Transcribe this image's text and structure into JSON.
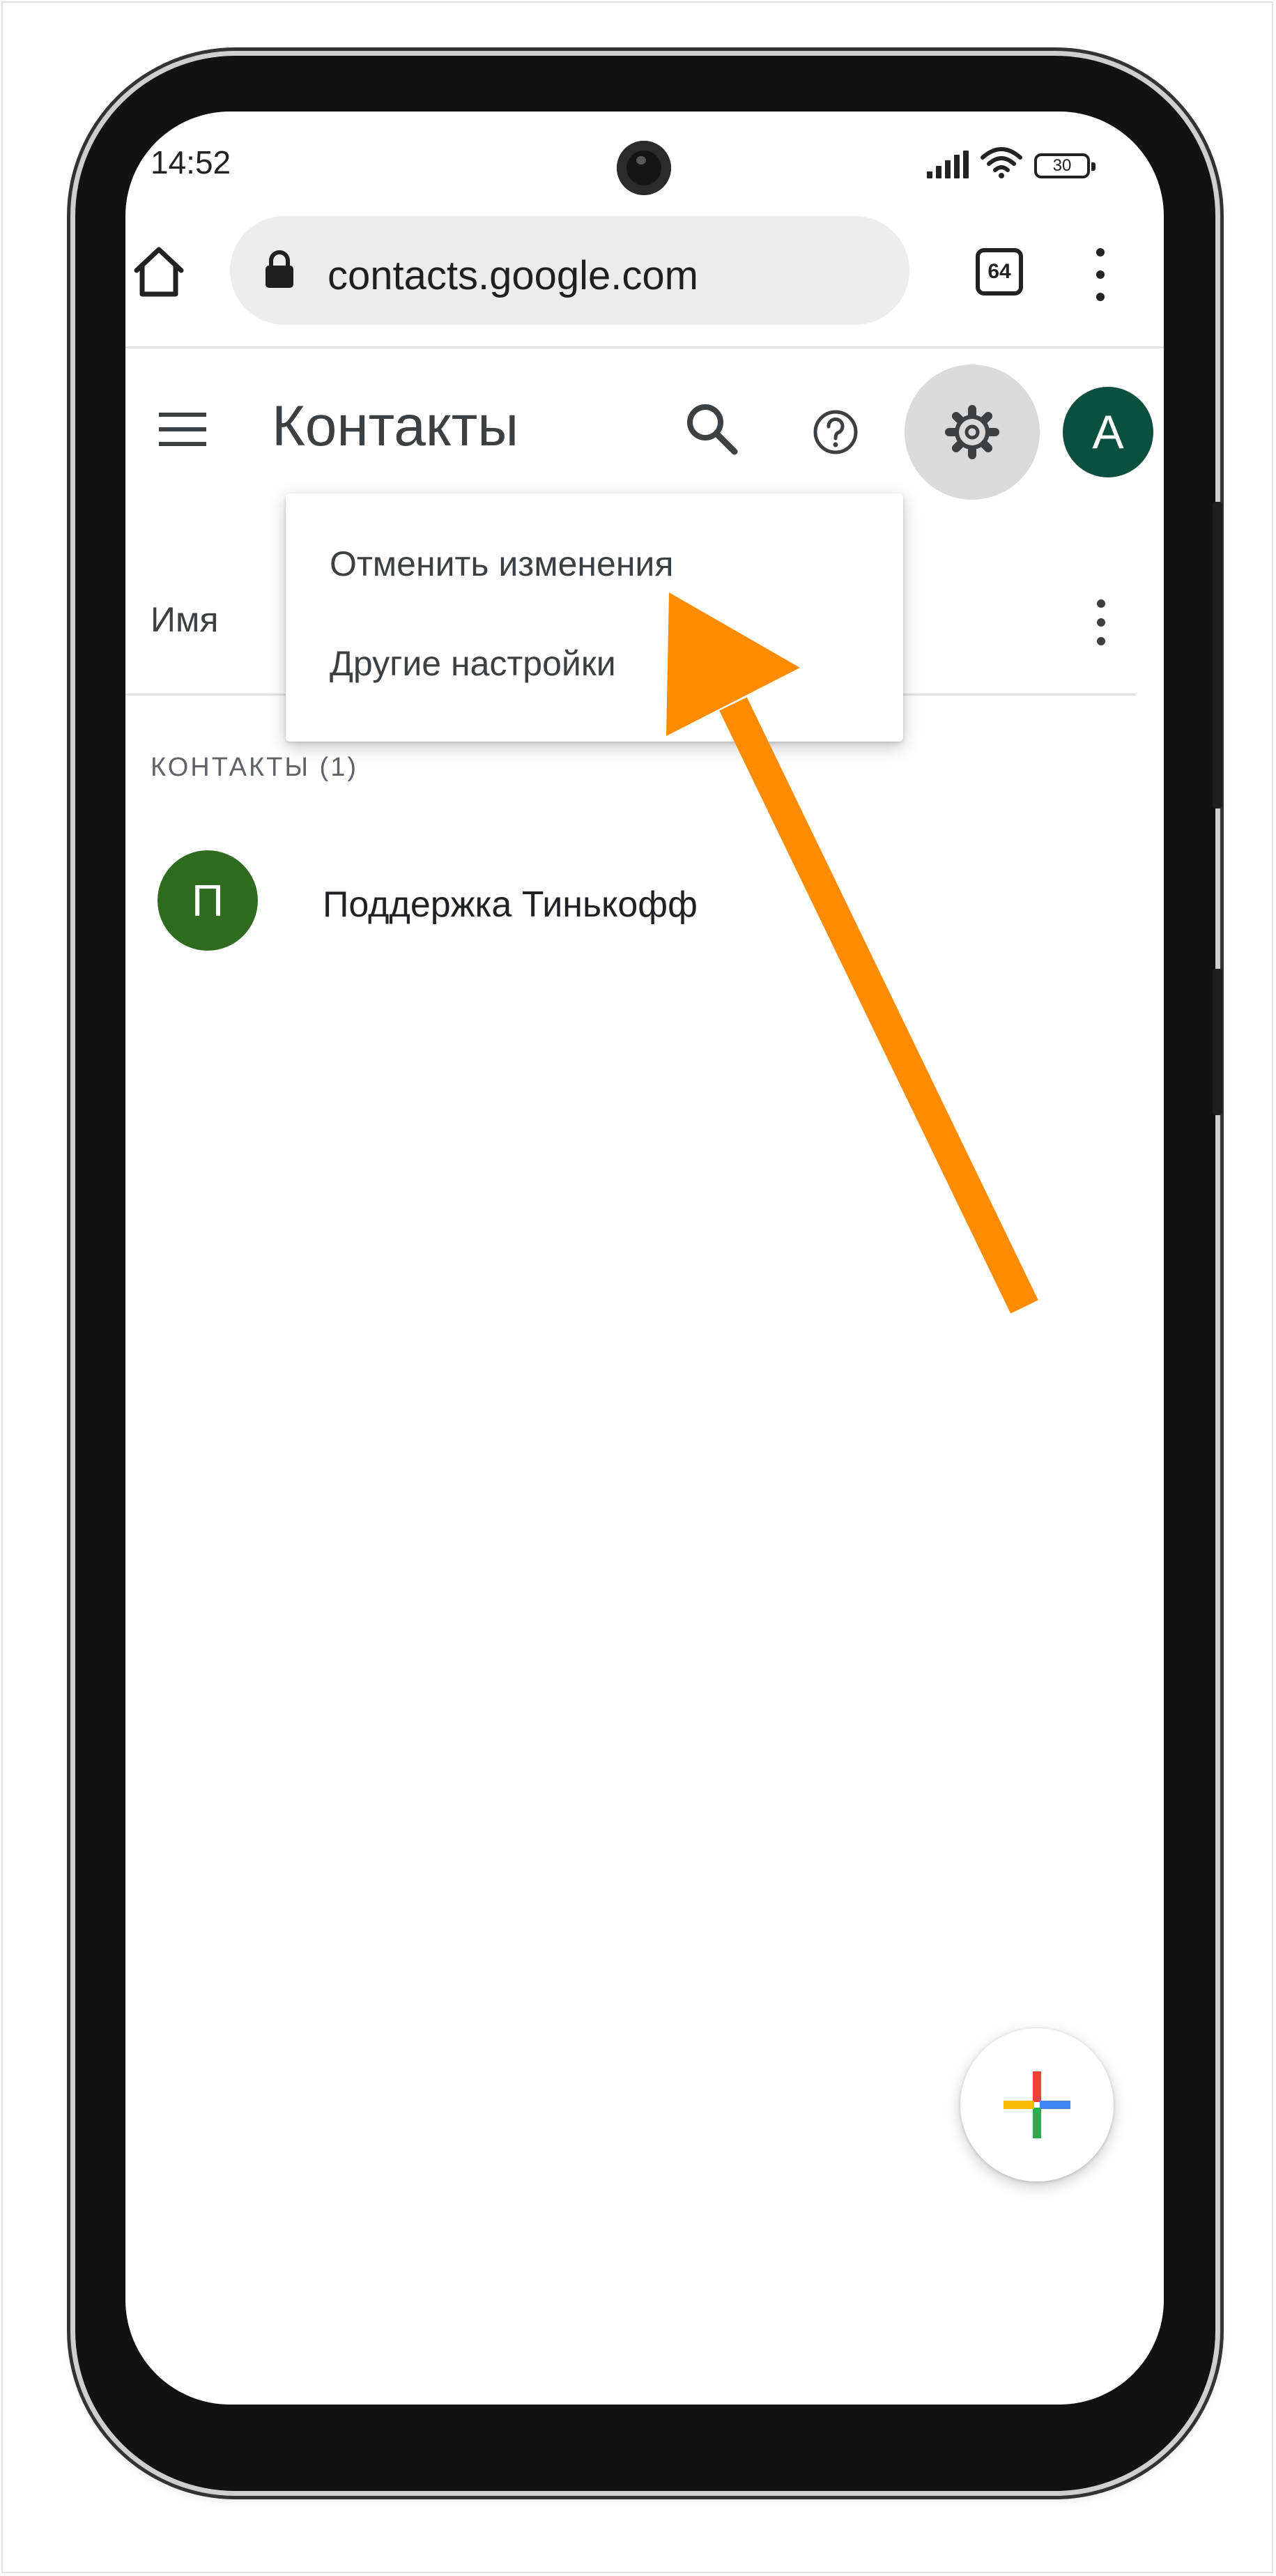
{
  "status_bar": {
    "time": "14:52",
    "battery": "30"
  },
  "browser": {
    "url": "contacts.google.com",
    "tab_count": "64"
  },
  "header": {
    "title": "Контакты"
  },
  "list_header": {
    "column_name": "Имя"
  },
  "settings_menu": {
    "items": [
      "Отменить изменения",
      "Другие настройки"
    ]
  },
  "contacts_section": {
    "label": "КОНТАКТЫ (1)",
    "items": [
      {
        "initial": "П",
        "name": "Поддержка Тинькофф"
      }
    ]
  },
  "account": {
    "initial": "A"
  },
  "icons": [
    "home-icon",
    "lock-icon",
    "tabs-icon",
    "more-vert-icon",
    "menu-icon",
    "search-icon",
    "help-icon",
    "gear-icon",
    "add-icon"
  ],
  "colors": {
    "accent_arrow": "#FF8C00",
    "avatar_account": "#0B4F3F",
    "avatar_contact": "#2E6B1F"
  }
}
